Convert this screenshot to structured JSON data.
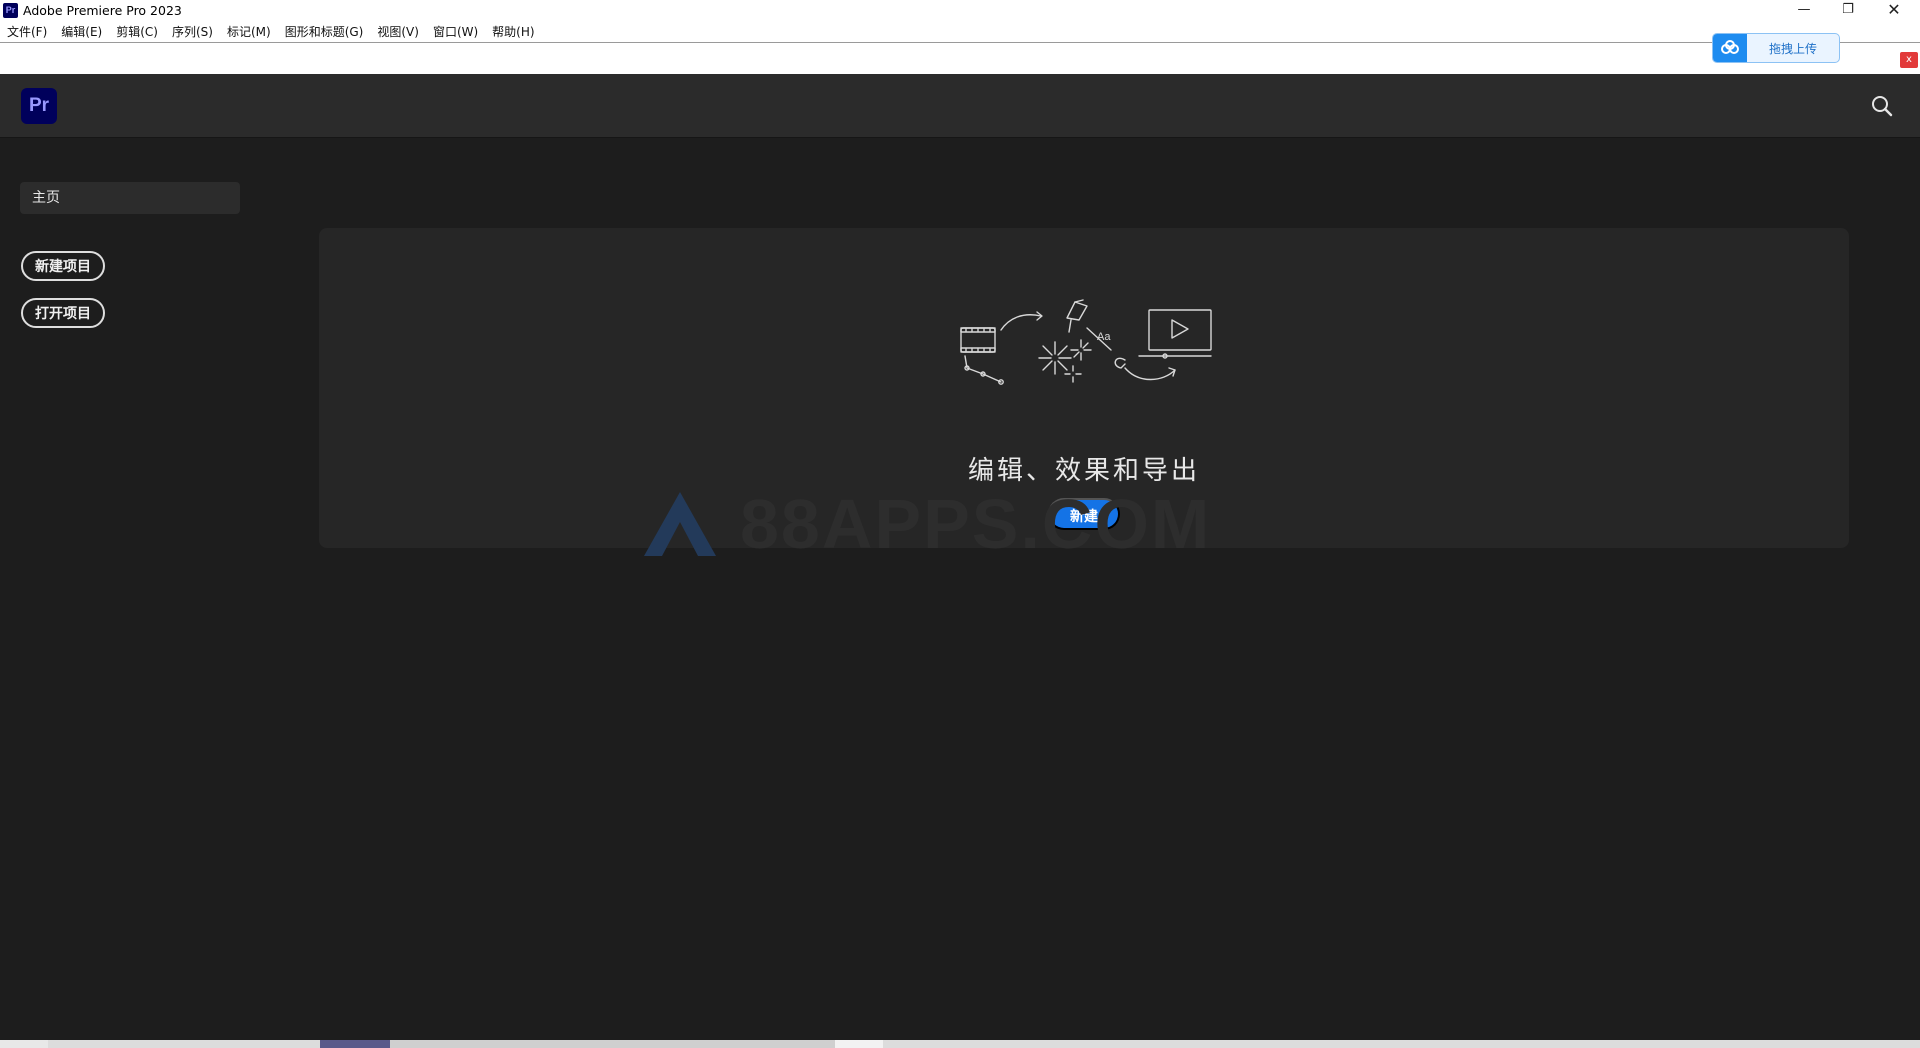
{
  "window": {
    "app_icon_text": "Pr",
    "title": "Adobe Premiere Pro 2023",
    "minimize_glyph": "—",
    "maximize_glyph": "❐",
    "close_glyph": "✕"
  },
  "menubar": {
    "items": [
      "文件(F)",
      "编辑(E)",
      "剪辑(C)",
      "序列(S)",
      "标记(M)",
      "图形和标题(G)",
      "视图(V)",
      "窗口(W)",
      "帮助(H)"
    ]
  },
  "upload_widget": {
    "label": "拖拽上传",
    "icon": "cloud-icon",
    "close_glyph": "x"
  },
  "header": {
    "logo_text": "Pr",
    "search_icon": "search-icon"
  },
  "nav": {
    "home_label": "主页",
    "new_project_label": "新建项目",
    "open_project_label": "打开项目"
  },
  "main": {
    "title": "编辑、效果和导出",
    "new_button_label": "新建"
  },
  "watermark": {
    "text": "88APPS.COM"
  },
  "colors": {
    "accent": "#1473e6",
    "background": "#1d1d1d",
    "header": "#2b2b2b",
    "card": "#262626",
    "pr_logo_bg": "#00005b",
    "pr_logo_fg": "#9999ff"
  }
}
